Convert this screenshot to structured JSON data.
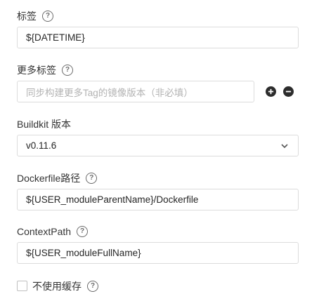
{
  "fields": {
    "tag": {
      "label": "标签",
      "value": "${DATETIME}"
    },
    "more_tags": {
      "label": "更多标签",
      "placeholder": "同步构建更多Tag的镜像版本（非必填）"
    },
    "buildkit": {
      "label": "Buildkit 版本",
      "value": "v0.11.6"
    },
    "dockerfile": {
      "label": "Dockerfile路径",
      "value": "${USER_moduleParentName}/Dockerfile"
    },
    "context": {
      "label": "ContextPath",
      "value": "${USER_moduleFullName}"
    },
    "no_cache": {
      "label": "不使用缓存",
      "checked": false
    }
  },
  "icons": {
    "help": "question-circle-icon",
    "add": "plus-circle-icon",
    "remove": "minus-circle-icon",
    "dropdown": "chevron-down-icon"
  },
  "colors": {
    "border": "#dcdcdc",
    "icon_dark": "#2c2c2c"
  }
}
